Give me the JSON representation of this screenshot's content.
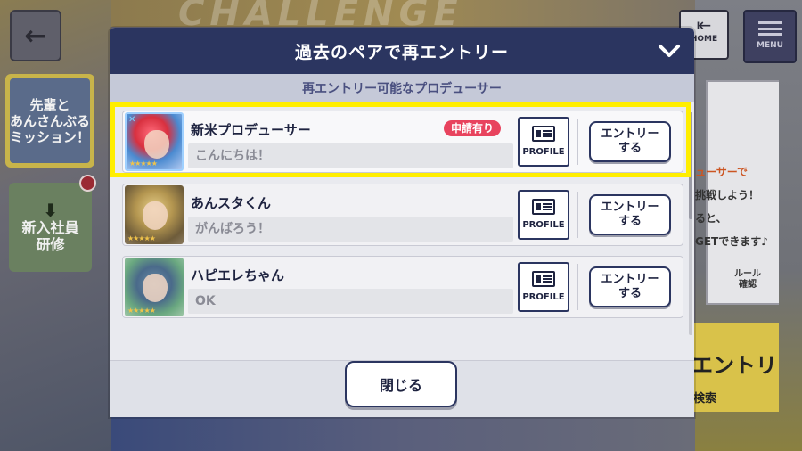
{
  "background": {
    "ghost_title": "CHALLENGE",
    "back_icon": "arrow-left-icon",
    "home": {
      "label": "HOME",
      "icon": "exit-icon"
    },
    "menu": {
      "label": "MENU",
      "icon": "hamburger-icon"
    },
    "mission_panel": "先輩と\nあんさんぶる\nミッション！",
    "shinnyu_panel": "新入社員\n研修",
    "right_card_lines": [
      "挑戦しよう！",
      "ると、",
      "GETできます♪"
    ],
    "right_card_accent": "ューサーで",
    "rule_label": "ルール\n確認",
    "yellow_card": {
      "big": "エントリー",
      "small": "検索"
    }
  },
  "dialog": {
    "title": "過去のペアで再エントリー",
    "subtitle": "再エントリー可能なプロデューサー",
    "close_label": "閉じる"
  },
  "entries": [
    {
      "name": "新米プロデューサー",
      "message": "こんにちは！",
      "badge": "申請有り",
      "profile_label": "PROFILE",
      "entry_label": "エントリー\nする"
    },
    {
      "name": "あんスタくん",
      "message": "がんばろう！",
      "profile_label": "PROFILE",
      "entry_label": "エントリー\nする"
    },
    {
      "name": "ハピエレちゃん",
      "message": "OK",
      "profile_label": "PROFILE",
      "entry_label": "エントリー\nする"
    }
  ],
  "colors": {
    "header": "#2b3560",
    "badge": "#e8435e",
    "highlight": "#ffee00"
  }
}
